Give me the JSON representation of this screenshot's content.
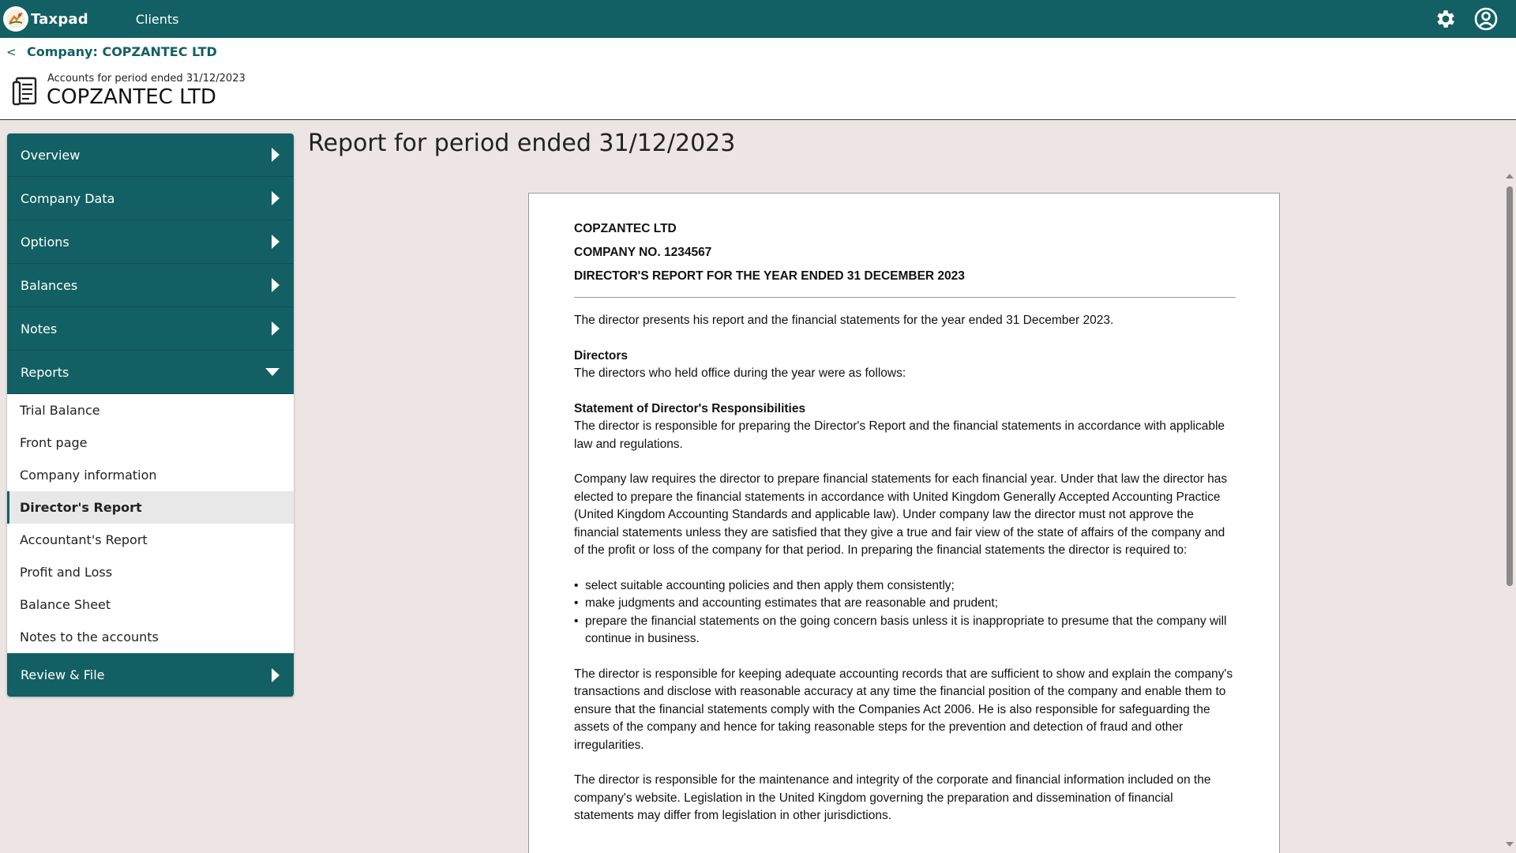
{
  "app": {
    "name": "Taxpad",
    "nav_clients": "Clients",
    "icons": [
      "settings-icon",
      "account-icon"
    ]
  },
  "breadcrumb": {
    "back": "<",
    "label": "Company: COPZANTEC LTD"
  },
  "header": {
    "subtitle": "Accounts for period ended 31/12/2023",
    "title": "COPZANTEC LTD"
  },
  "sidebar": {
    "sections": [
      {
        "label": "Overview",
        "state": "collapsed"
      },
      {
        "label": "Company Data",
        "state": "collapsed"
      },
      {
        "label": "Options",
        "state": "collapsed"
      },
      {
        "label": "Balances",
        "state": "collapsed"
      },
      {
        "label": "Notes",
        "state": "collapsed"
      },
      {
        "label": "Reports",
        "state": "expanded"
      },
      {
        "label": "Review & File",
        "state": "collapsed"
      }
    ],
    "report_items": [
      "Trial Balance",
      "Front page",
      "Company information",
      "Director's Report",
      "Accountant's Report",
      "Profit and Loss",
      "Balance Sheet",
      "Notes to the accounts"
    ],
    "active_item": "Director's Report"
  },
  "main": {
    "heading": "Report for period ended 31/12/2023"
  },
  "report": {
    "company": "COPZANTEC LTD",
    "company_no": "COMPANY NO. 1234567",
    "report_title": "DIRECTOR'S REPORT FOR THE YEAR ENDED 31 DECEMBER 2023",
    "intro": "The director presents his report and the financial statements for the year ended 31 December 2023.",
    "directors_heading": "Directors",
    "directors_text": "The directors who held office during the year were as follows:",
    "responsibilities_heading": "Statement of Director's Responsibilities",
    "responsibilities_text": "The director is responsible for preparing the Director's Report and the financial statements in accordance with applicable law and regulations.",
    "company_law_text": "Company law requires the director to prepare financial statements for each financial year. Under that law the director has elected to prepare the financial statements in accordance with United Kingdom Generally Accepted Accounting Practice (United Kingdom Accounting Standards and applicable law). Under company law the director must not approve the financial statements unless they are satisfied that they give a true and fair view of the state of affairs of the company and of the profit or loss of the company for that period. In preparing the financial statements the director is required to:",
    "bullet_1": "select suitable accounting policies and then apply them consistently;",
    "bullet_2": "make judgments and accounting estimates that are reasonable and prudent;",
    "bullet_3": "prepare the financial statements on the going concern basis unless it is inappropriate to presume that the company will continue in business.",
    "records_text": "The director is responsible for keeping adequate accounting records that are sufficient to show and explain the company's transactions and disclose with reasonable accuracy at any time the financial position of the company and enable them to ensure that the financial statements comply with the Companies Act 2006. He is also responsible for safeguarding the assets of the company and hence for taking reasonable steps for the prevention and detection of fraud and other irregularities.",
    "website_text": "The director is responsible for the maintenance and integrity of the corporate and financial information included on the company's website. Legislation in the United Kingdom governing the preparation and dissemination of financial statements may differ from legislation in other jurisdictions."
  },
  "colors": {
    "brand": "#136064",
    "page_bg": "#ede5e4",
    "active_item_bg": "#e8e8e8"
  }
}
